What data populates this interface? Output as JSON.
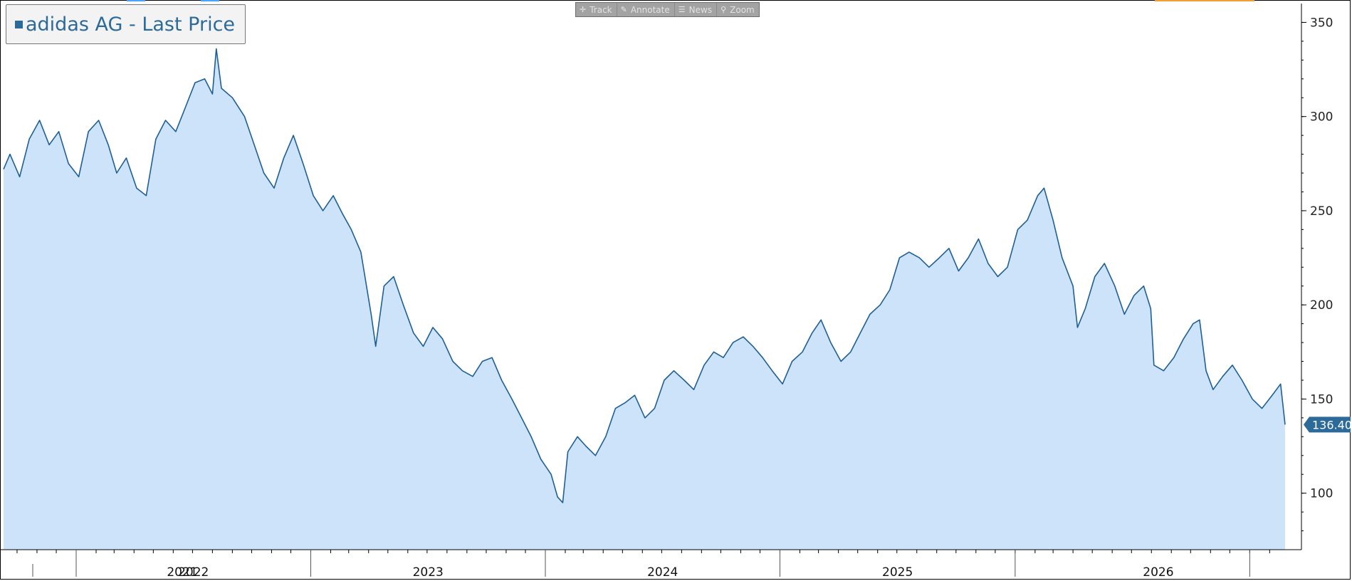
{
  "toolbar": {
    "buttons": [
      {
        "label": "Track",
        "icon": "move-icon"
      },
      {
        "label": "Annotate",
        "icon": "pencil-icon"
      },
      {
        "label": "News",
        "icon": "news-icon"
      },
      {
        "label": "Zoom",
        "icon": "magnifier-icon"
      }
    ]
  },
  "legend": {
    "text": "adidas AG - Last Price",
    "color": "#2c6a9a"
  },
  "last_price_label": "136.40",
  "colors": {
    "line": "#1f5f95",
    "fill": "#cce3fa",
    "badge": "#2c6a9a",
    "grid": "#000000"
  },
  "chart_data": {
    "type": "area",
    "title": "adidas AG - Last Price",
    "ylim": [
      70,
      360
    ],
    "yticks": [
      100,
      150,
      200,
      250,
      300,
      350
    ],
    "x_range": [
      "2020-09-10",
      "2026-02-25"
    ],
    "year_labels": [
      "2021",
      "2022",
      "2023",
      "2024",
      "2025",
      "2026"
    ],
    "grid": false,
    "legend_position": "top-left",
    "last_value": 136.4,
    "series": [
      {
        "name": "adidas AG - Last Price",
        "points": [
          [
            "2020-09-10",
            272
          ],
          [
            "2020-09-20",
            280
          ],
          [
            "2020-10-05",
            268
          ],
          [
            "2020-10-20",
            288
          ],
          [
            "2020-11-05",
            298
          ],
          [
            "2020-11-20",
            285
          ],
          [
            "2020-12-05",
            292
          ],
          [
            "2020-12-20",
            275
          ],
          [
            "2021-01-05",
            268
          ],
          [
            "2021-01-20",
            292
          ],
          [
            "2021-02-05",
            298
          ],
          [
            "2021-02-20",
            285
          ],
          [
            "2021-03-05",
            270
          ],
          [
            "2021-03-20",
            278
          ],
          [
            "2021-04-05",
            262
          ],
          [
            "2021-04-20",
            258
          ],
          [
            "2021-05-05",
            288
          ],
          [
            "2021-05-20",
            298
          ],
          [
            "2021-06-05",
            292
          ],
          [
            "2021-06-20",
            305
          ],
          [
            "2021-07-05",
            318
          ],
          [
            "2021-07-20",
            320
          ],
          [
            "2021-08-01",
            312
          ],
          [
            "2021-08-07",
            336
          ],
          [
            "2021-08-15",
            315
          ],
          [
            "2021-09-01",
            310
          ],
          [
            "2021-09-20",
            300
          ],
          [
            "2021-10-05",
            285
          ],
          [
            "2021-10-20",
            270
          ],
          [
            "2021-11-05",
            262
          ],
          [
            "2021-11-20",
            278
          ],
          [
            "2021-12-05",
            290
          ],
          [
            "2021-12-20",
            275
          ],
          [
            "2022-01-05",
            258
          ],
          [
            "2022-01-20",
            250
          ],
          [
            "2022-02-05",
            258
          ],
          [
            "2022-02-20",
            248
          ],
          [
            "2022-03-05",
            240
          ],
          [
            "2022-03-20",
            228
          ],
          [
            "2022-04-05",
            195
          ],
          [
            "2022-04-12",
            178
          ],
          [
            "2022-04-25",
            210
          ],
          [
            "2022-05-10",
            215
          ],
          [
            "2022-05-25",
            200
          ],
          [
            "2022-06-10",
            185
          ],
          [
            "2022-06-25",
            178
          ],
          [
            "2022-07-10",
            188
          ],
          [
            "2022-07-25",
            182
          ],
          [
            "2022-08-10",
            170
          ],
          [
            "2022-08-25",
            165
          ],
          [
            "2022-09-10",
            162
          ],
          [
            "2022-09-25",
            170
          ],
          [
            "2022-10-10",
            172
          ],
          [
            "2022-10-25",
            160
          ],
          [
            "2022-11-10",
            150
          ],
          [
            "2022-11-25",
            140
          ],
          [
            "2022-12-10",
            130
          ],
          [
            "2022-12-25",
            118
          ],
          [
            "2023-01-10",
            110
          ],
          [
            "2023-01-20",
            98
          ],
          [
            "2023-01-28",
            95
          ],
          [
            "2023-02-05",
            122
          ],
          [
            "2023-02-20",
            130
          ],
          [
            "2023-03-05",
            125
          ],
          [
            "2023-03-20",
            120
          ],
          [
            "2023-04-05",
            130
          ],
          [
            "2023-04-20",
            145
          ],
          [
            "2023-05-05",
            148
          ],
          [
            "2023-05-20",
            152
          ],
          [
            "2023-06-05",
            140
          ],
          [
            "2023-06-20",
            145
          ],
          [
            "2023-07-05",
            160
          ],
          [
            "2023-07-20",
            165
          ],
          [
            "2023-08-05",
            160
          ],
          [
            "2023-08-20",
            155
          ],
          [
            "2023-09-05",
            168
          ],
          [
            "2023-09-20",
            175
          ],
          [
            "2023-10-05",
            172
          ],
          [
            "2023-10-20",
            180
          ],
          [
            "2023-11-05",
            183
          ],
          [
            "2023-11-20",
            178
          ],
          [
            "2023-12-05",
            172
          ],
          [
            "2023-12-20",
            165
          ],
          [
            "2024-01-05",
            158
          ],
          [
            "2024-01-20",
            170
          ],
          [
            "2024-02-05",
            175
          ],
          [
            "2024-02-20",
            185
          ],
          [
            "2024-03-05",
            192
          ],
          [
            "2024-03-20",
            180
          ],
          [
            "2024-04-05",
            170
          ],
          [
            "2024-04-20",
            175
          ],
          [
            "2024-05-05",
            185
          ],
          [
            "2024-05-20",
            195
          ],
          [
            "2024-06-05",
            200
          ],
          [
            "2024-06-20",
            208
          ],
          [
            "2024-07-05",
            225
          ],
          [
            "2024-07-20",
            228
          ],
          [
            "2024-08-05",
            225
          ],
          [
            "2024-08-20",
            220
          ],
          [
            "2024-09-05",
            225
          ],
          [
            "2024-09-20",
            230
          ],
          [
            "2024-10-05",
            218
          ],
          [
            "2024-10-20",
            225
          ],
          [
            "2024-11-05",
            235
          ],
          [
            "2024-11-20",
            222
          ],
          [
            "2024-12-05",
            215
          ],
          [
            "2024-12-20",
            220
          ],
          [
            "2025-01-05",
            240
          ],
          [
            "2025-01-20",
            245
          ],
          [
            "2025-02-05",
            258
          ],
          [
            "2025-02-15",
            262
          ],
          [
            "2025-03-01",
            245
          ],
          [
            "2025-03-15",
            225
          ],
          [
            "2025-04-01",
            210
          ],
          [
            "2025-04-08",
            188
          ],
          [
            "2025-04-20",
            198
          ],
          [
            "2025-05-05",
            215
          ],
          [
            "2025-05-20",
            222
          ],
          [
            "2025-06-05",
            210
          ],
          [
            "2025-06-20",
            195
          ],
          [
            "2025-07-05",
            205
          ],
          [
            "2025-07-20",
            210
          ],
          [
            "2025-07-31",
            198
          ],
          [
            "2025-08-05",
            168
          ],
          [
            "2025-08-20",
            165
          ],
          [
            "2025-09-05",
            172
          ],
          [
            "2025-09-20",
            182
          ],
          [
            "2025-10-05",
            190
          ],
          [
            "2025-10-15",
            192
          ],
          [
            "2025-10-25",
            165
          ],
          [
            "2025-11-05",
            155
          ],
          [
            "2025-11-20",
            162
          ],
          [
            "2025-12-05",
            168
          ],
          [
            "2025-12-20",
            160
          ],
          [
            "2026-01-05",
            150
          ],
          [
            "2026-01-20",
            145
          ],
          [
            "2026-02-05",
            152
          ],
          [
            "2026-02-18",
            158
          ],
          [
            "2026-02-25",
            136.4
          ]
        ]
      }
    ]
  }
}
